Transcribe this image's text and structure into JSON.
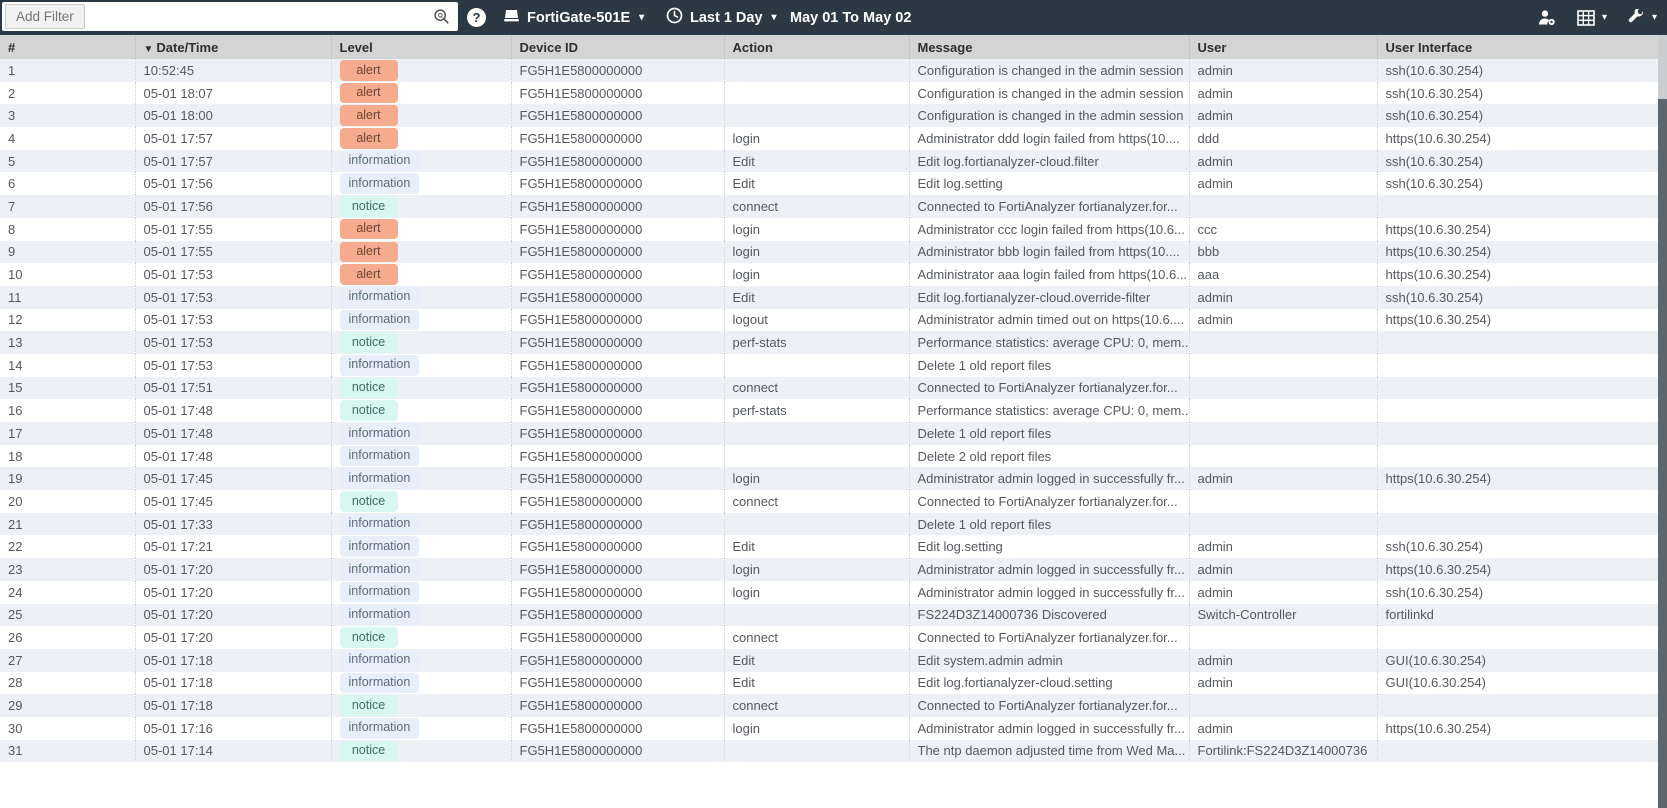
{
  "topbar": {
    "filter_chip": "Add Filter",
    "help_glyph": "?",
    "device_selector": {
      "label": "FortiGate-501E"
    },
    "time_selector": {
      "label": "Last 1 Day"
    },
    "date_range": "May 01 To May 02"
  },
  "colors": {
    "navbar": "#2c3945",
    "header_bg": "#d4d4d4",
    "stripe": "#edf1f5",
    "badge_alert": "#f7ab8e",
    "badge_information": "#e8eefa",
    "badge_notice": "#d8f7f0"
  },
  "table": {
    "columns": [
      {
        "label": "#"
      },
      {
        "label": "Date/Time",
        "sorted": "desc"
      },
      {
        "label": "Level"
      },
      {
        "label": "Device ID"
      },
      {
        "label": "Action"
      },
      {
        "label": "Message"
      },
      {
        "label": "User"
      },
      {
        "label": "User Interface"
      }
    ],
    "rows": [
      {
        "n": "1",
        "time": "10:52:45",
        "level": "alert",
        "device": "FG5H1E5800000000",
        "action": "",
        "msg": "Configuration is changed in the admin session",
        "user": "admin",
        "ui": "ssh(10.6.30.254)"
      },
      {
        "n": "2",
        "time": "05-01 18:07",
        "level": "alert",
        "device": "FG5H1E5800000000",
        "action": "",
        "msg": "Configuration is changed in the admin session",
        "user": "admin",
        "ui": "ssh(10.6.30.254)"
      },
      {
        "n": "3",
        "time": "05-01 18:00",
        "level": "alert",
        "device": "FG5H1E5800000000",
        "action": "",
        "msg": "Configuration is changed in the admin session",
        "user": "admin",
        "ui": "ssh(10.6.30.254)"
      },
      {
        "n": "4",
        "time": "05-01 17:57",
        "level": "alert",
        "device": "FG5H1E5800000000",
        "action": "login",
        "msg": "Administrator ddd login failed from https(10....",
        "user": "ddd",
        "ui": "https(10.6.30.254)"
      },
      {
        "n": "5",
        "time": "05-01 17:57",
        "level": "information",
        "device": "FG5H1E5800000000",
        "action": "Edit",
        "msg": "Edit log.fortianalyzer-cloud.filter",
        "user": "admin",
        "ui": "ssh(10.6.30.254)"
      },
      {
        "n": "6",
        "time": "05-01 17:56",
        "level": "information",
        "device": "FG5H1E5800000000",
        "action": "Edit",
        "msg": "Edit log.setting",
        "user": "admin",
        "ui": "ssh(10.6.30.254)"
      },
      {
        "n": "7",
        "time": "05-01 17:56",
        "level": "notice",
        "device": "FG5H1E5800000000",
        "action": "connect",
        "msg": "Connected to FortiAnalyzer fortianalyzer.for...",
        "user": "",
        "ui": ""
      },
      {
        "n": "8",
        "time": "05-01 17:55",
        "level": "alert",
        "device": "FG5H1E5800000000",
        "action": "login",
        "msg": "Administrator ccc login failed from https(10.6...",
        "user": "ccc",
        "ui": "https(10.6.30.254)"
      },
      {
        "n": "9",
        "time": "05-01 17:55",
        "level": "alert",
        "device": "FG5H1E5800000000",
        "action": "login",
        "msg": "Administrator bbb login failed from https(10....",
        "user": "bbb",
        "ui": "https(10.6.30.254)"
      },
      {
        "n": "10",
        "time": "05-01 17:53",
        "level": "alert",
        "device": "FG5H1E5800000000",
        "action": "login",
        "msg": "Administrator aaa login failed from https(10.6...",
        "user": "aaa",
        "ui": "https(10.6.30.254)"
      },
      {
        "n": "11",
        "time": "05-01 17:53",
        "level": "information",
        "device": "FG5H1E5800000000",
        "action": "Edit",
        "msg": "Edit log.fortianalyzer-cloud.override-filter",
        "user": "admin",
        "ui": "ssh(10.6.30.254)"
      },
      {
        "n": "12",
        "time": "05-01 17:53",
        "level": "information",
        "device": "FG5H1E5800000000",
        "action": "logout",
        "msg": "Administrator admin timed out on https(10.6....",
        "user": "admin",
        "ui": "https(10.6.30.254)"
      },
      {
        "n": "13",
        "time": "05-01 17:53",
        "level": "notice",
        "device": "FG5H1E5800000000",
        "action": "perf-stats",
        "msg": "Performance statistics: average CPU: 0, mem...",
        "user": "",
        "ui": ""
      },
      {
        "n": "14",
        "time": "05-01 17:53",
        "level": "information",
        "device": "FG5H1E5800000000",
        "action": "",
        "msg": "Delete 1 old report files",
        "user": "",
        "ui": ""
      },
      {
        "n": "15",
        "time": "05-01 17:51",
        "level": "notice",
        "device": "FG5H1E5800000000",
        "action": "connect",
        "msg": "Connected to FortiAnalyzer fortianalyzer.for...",
        "user": "",
        "ui": ""
      },
      {
        "n": "16",
        "time": "05-01 17:48",
        "level": "notice",
        "device": "FG5H1E5800000000",
        "action": "perf-stats",
        "msg": "Performance statistics: average CPU: 0, mem...",
        "user": "",
        "ui": ""
      },
      {
        "n": "17",
        "time": "05-01 17:48",
        "level": "information",
        "device": "FG5H1E5800000000",
        "action": "",
        "msg": "Delete 1 old report files",
        "user": "",
        "ui": ""
      },
      {
        "n": "18",
        "time": "05-01 17:48",
        "level": "information",
        "device": "FG5H1E5800000000",
        "action": "",
        "msg": "Delete 2 old report files",
        "user": "",
        "ui": ""
      },
      {
        "n": "19",
        "time": "05-01 17:45",
        "level": "information",
        "device": "FG5H1E5800000000",
        "action": "login",
        "msg": "Administrator admin logged in successfully fr...",
        "user": "admin",
        "ui": "https(10.6.30.254)"
      },
      {
        "n": "20",
        "time": "05-01 17:45",
        "level": "notice",
        "device": "FG5H1E5800000000",
        "action": "connect",
        "msg": "Connected to FortiAnalyzer fortianalyzer.for...",
        "user": "",
        "ui": ""
      },
      {
        "n": "21",
        "time": "05-01 17:33",
        "level": "information",
        "device": "FG5H1E5800000000",
        "action": "",
        "msg": "Delete 1 old report files",
        "user": "",
        "ui": ""
      },
      {
        "n": "22",
        "time": "05-01 17:21",
        "level": "information",
        "device": "FG5H1E5800000000",
        "action": "Edit",
        "msg": "Edit log.setting",
        "user": "admin",
        "ui": "ssh(10.6.30.254)"
      },
      {
        "n": "23",
        "time": "05-01 17:20",
        "level": "information",
        "device": "FG5H1E5800000000",
        "action": "login",
        "msg": "Administrator admin logged in successfully fr...",
        "user": "admin",
        "ui": "https(10.6.30.254)"
      },
      {
        "n": "24",
        "time": "05-01 17:20",
        "level": "information",
        "device": "FG5H1E5800000000",
        "action": "login",
        "msg": "Administrator admin logged in successfully fr...",
        "user": "admin",
        "ui": "ssh(10.6.30.254)"
      },
      {
        "n": "25",
        "time": "05-01 17:20",
        "level": "information",
        "device": "FG5H1E5800000000",
        "action": "",
        "msg": "FS224D3Z14000736 Discovered",
        "user": "Switch-Controller",
        "ui": "fortilinkd"
      },
      {
        "n": "26",
        "time": "05-01 17:20",
        "level": "notice",
        "device": "FG5H1E5800000000",
        "action": "connect",
        "msg": "Connected to FortiAnalyzer fortianalyzer.for...",
        "user": "",
        "ui": ""
      },
      {
        "n": "27",
        "time": "05-01 17:18",
        "level": "information",
        "device": "FG5H1E5800000000",
        "action": "Edit",
        "msg": "Edit system.admin admin",
        "user": "admin",
        "ui": "GUI(10.6.30.254)"
      },
      {
        "n": "28",
        "time": "05-01 17:18",
        "level": "information",
        "device": "FG5H1E5800000000",
        "action": "Edit",
        "msg": "Edit log.fortianalyzer-cloud.setting",
        "user": "admin",
        "ui": "GUI(10.6.30.254)"
      },
      {
        "n": "29",
        "time": "05-01 17:18",
        "level": "notice",
        "device": "FG5H1E5800000000",
        "action": "connect",
        "msg": "Connected to FortiAnalyzer fortianalyzer.for...",
        "user": "",
        "ui": ""
      },
      {
        "n": "30",
        "time": "05-01 17:16",
        "level": "information",
        "device": "FG5H1E5800000000",
        "action": "login",
        "msg": "Administrator admin logged in successfully fr...",
        "user": "admin",
        "ui": "https(10.6.30.254)"
      },
      {
        "n": "31",
        "time": "05-01 17:14",
        "level": "notice",
        "device": "FG5H1E5800000000",
        "action": "",
        "msg": "The ntp daemon adjusted time from Wed Ma...",
        "user": "Fortilink:FS224D3Z14000736",
        "ui": ""
      }
    ]
  }
}
